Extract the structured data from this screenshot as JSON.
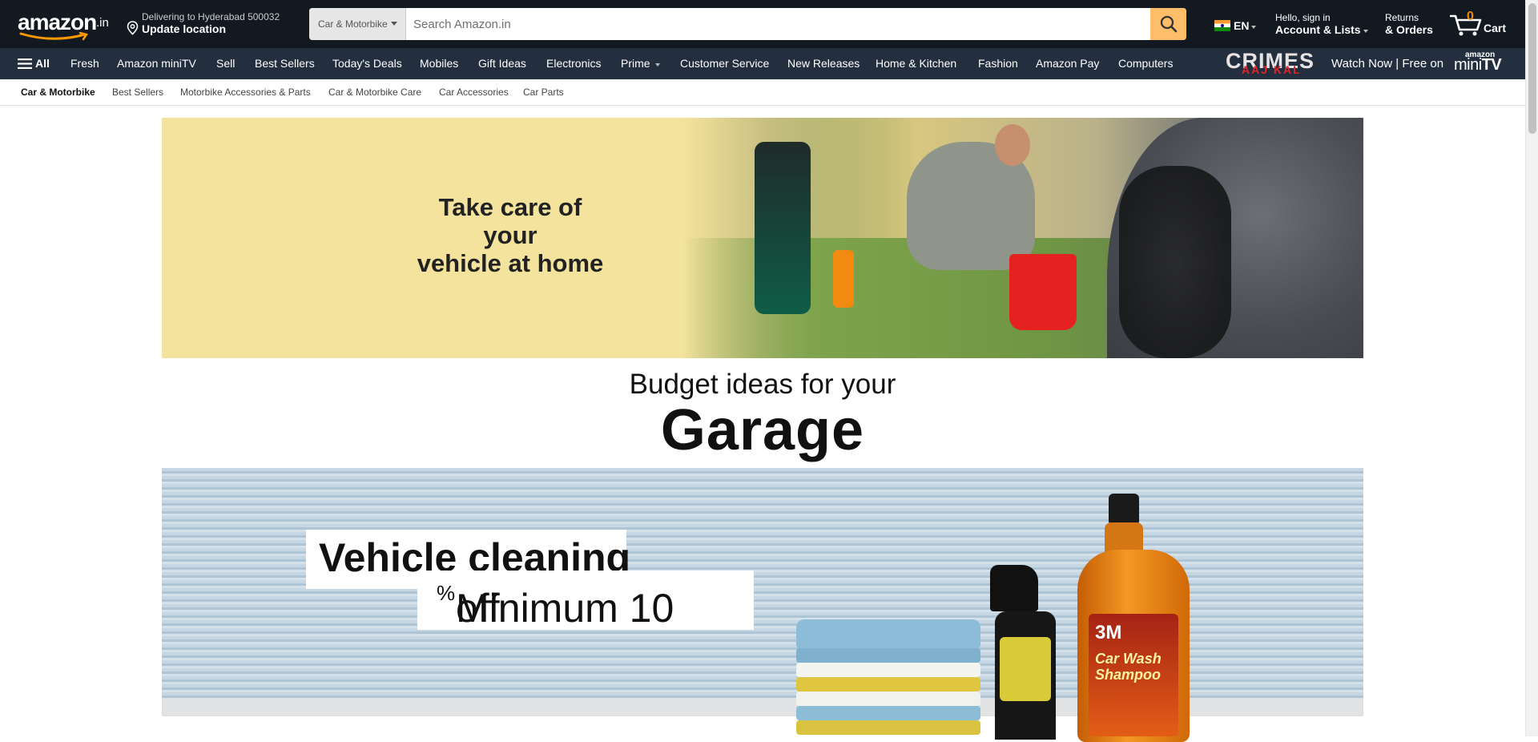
{
  "header": {
    "logo_text": "amazon",
    "logo_domain": ".in",
    "delivery": {
      "line1": "Delivering to Hyderabad 500032",
      "line2": "Update location"
    },
    "search": {
      "category": "Car & Motorbike",
      "placeholder": "Search Amazon.in"
    },
    "language": "EN",
    "account": {
      "line1": "Hello, sign in",
      "line2": "Account & Lists"
    },
    "returns": {
      "line1": "Returns",
      "line2": "& Orders"
    },
    "cart": {
      "count": "0",
      "label": "Cart"
    }
  },
  "nav": {
    "all_label": "All",
    "items": [
      "Fresh",
      "Amazon miniTV",
      "Sell",
      "Best Sellers",
      "Today's Deals",
      "Mobiles",
      "Gift Ideas",
      "Electronics",
      "Prime",
      "Customer Service",
      "New Releases",
      "Home & Kitchen",
      "Fashion",
      "Amazon Pay",
      "Computers"
    ],
    "promo": {
      "show_title": "CRIMES",
      "show_subtitle": "AAJ KAL",
      "text": "Watch Now | Free on",
      "brand_top": "amazon",
      "brand_mini": "mini",
      "brand_tv": "TV"
    }
  },
  "subnav": {
    "items": [
      "Car & Motorbike",
      "Best Sellers",
      "Motorbike Accessories & Parts",
      "Car & Motorbike Care",
      "Car Accessories",
      "Car Parts"
    ]
  },
  "banner1": {
    "headline_line1": "Take care of your",
    "headline_line2": "vehicle at home"
  },
  "section": {
    "subtitle": "Budget ideas for your",
    "title": "Garage"
  },
  "banner2": {
    "headline": "Vehicle cleaning",
    "offer_prefix": "Minimum 10",
    "offer_percent": "%",
    "offer_suffix": " off",
    "product_brand": "3M",
    "product_name_line1": "Car Wash",
    "product_name_line2": "Shampoo"
  },
  "colors": {
    "nav_dark": "#131921",
    "nav_secondary": "#232f3e",
    "search_button": "#febd69",
    "cart_count": "#f08804",
    "banner_yellow": "#f3e39d"
  }
}
